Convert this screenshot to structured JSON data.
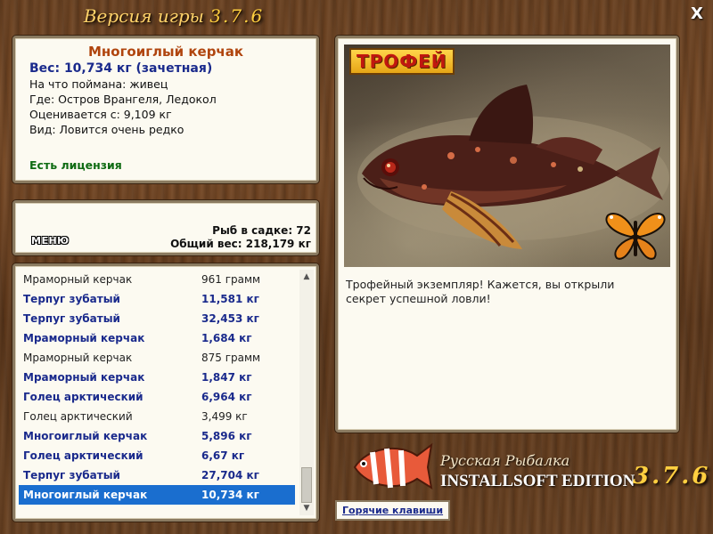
{
  "window": {
    "title_prefix": "Версия игры",
    "title_version": "3.7.6",
    "close_label": "X"
  },
  "fish_info": {
    "name": "Многоиглый керчак",
    "weight": "Вес: 10,734 кг (зачетная)",
    "bait": "На что поймана: живец",
    "location": "Где: Остров Врангеля, Ледокол",
    "valued_from": "Оценивается с: 9,109 кг",
    "rarity": "Вид: Ловится очень редко",
    "license": "Есть лицензия"
  },
  "stats": {
    "menu_label": "МЕНЮ",
    "fish_in_net": "Рыб в садке: 72",
    "total_weight": "Общий вес: 218,179 кг"
  },
  "catch_list": [
    {
      "name": "Мраморный керчак",
      "weight": "961 грамм",
      "style": "normal"
    },
    {
      "name": "Терпуг зубатый",
      "weight": "11,581 кг",
      "style": "trophy"
    },
    {
      "name": "Терпуг зубатый",
      "weight": "32,453 кг",
      "style": "trophy"
    },
    {
      "name": "Мраморный керчак",
      "weight": "1,684 кг",
      "style": "trophy"
    },
    {
      "name": "Мраморный керчак",
      "weight": "875 грамм",
      "style": "normal"
    },
    {
      "name": "Мраморный керчак",
      "weight": "1,847 кг",
      "style": "trophy"
    },
    {
      "name": "Голец арктический",
      "weight": "6,964 кг",
      "style": "trophy"
    },
    {
      "name": "Голец арктический",
      "weight": "3,499 кг",
      "style": "normal"
    },
    {
      "name": "Многоиглый керчак",
      "weight": "5,896 кг",
      "style": "trophy"
    },
    {
      "name": "Голец арктический",
      "weight": "6,67 кг",
      "style": "trophy"
    },
    {
      "name": "Терпуг зубатый",
      "weight": "27,704 кг",
      "style": "trophy"
    },
    {
      "name": "Многоиглый керчак",
      "weight": "10,734 кг",
      "style": "selected"
    }
  ],
  "photo": {
    "badge": "ТРОФЕЙ",
    "caption": "Трофейный экземпляр! Кажется, вы открыли секрет успешной ловли!",
    "icons": {
      "fish": "fish-photo",
      "butterfly": "butterfly-icon"
    }
  },
  "hotkeys_label": "Горячие клавиши",
  "brand": {
    "line1": "Русская Рыбалка",
    "line2": "INSTALLSOFT EDITION",
    "version": "3.7.6"
  },
  "colors": {
    "trophy_text": "#1a2a8c",
    "selected_bg": "#1a6ecf",
    "fish_name": "#b0450e",
    "license": "#0e6b12",
    "badge_text": "#c0170f"
  }
}
